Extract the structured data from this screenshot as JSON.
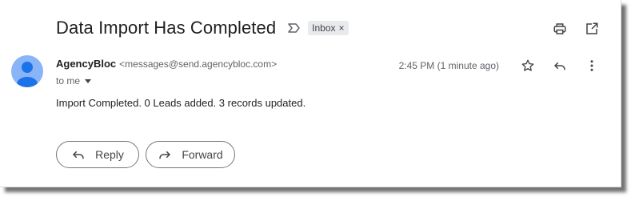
{
  "email": {
    "subject": "Data Import Has Completed",
    "label_chip": "Inbox",
    "label_chip_remove": "×",
    "sender_name": "AgencyBloc",
    "sender_email": "<messages@send.agencybloc.com>",
    "recipient": "to me",
    "timestamp": "2:45 PM (1 minute ago)",
    "body": "Import Completed. 0 Leads added. 3 records updated."
  },
  "actions": {
    "reply_label": "Reply",
    "forward_label": "Forward"
  },
  "icons": {
    "important": "important-marker-icon",
    "print": "print-icon",
    "open_new_window": "open-in-new-window-icon",
    "star": "star-icon",
    "reply": "reply-icon",
    "more": "more-vert-icon",
    "forward": "forward-icon",
    "avatar": "default-avatar-icon"
  },
  "colors": {
    "avatar_bg": "#8ab4f8",
    "chip_bg": "#e8eaed",
    "button_border": "#747775"
  }
}
